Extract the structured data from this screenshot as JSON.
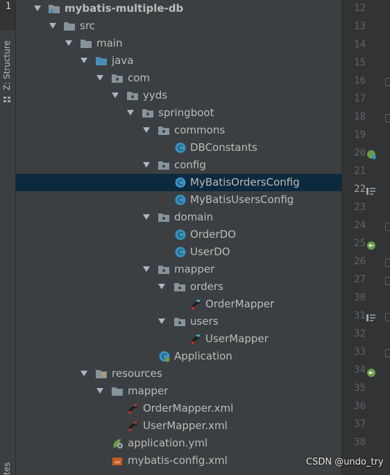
{
  "tool_stripe": {
    "top_number": "1",
    "structure_label": "Z: Structure",
    "bottom_label": "tes"
  },
  "tree": {
    "root": "mybatis-multiple-db",
    "src": "src",
    "main": "main",
    "java": "java",
    "com": "com",
    "yyds": "yyds",
    "springboot": "springboot",
    "commons": "commons",
    "db_constants": "DBConstants",
    "config": "config",
    "orders_config": "MyBatisOrdersConfig",
    "users_config": "MyBatisUsersConfig",
    "domain": "domain",
    "order_do": "OrderDO",
    "user_do": "UserDO",
    "mapper": "mapper",
    "orders": "orders",
    "order_mapper": "OrderMapper",
    "users": "users",
    "user_mapper": "UserMapper",
    "application": "Application",
    "resources": "resources",
    "res_mapper": "mapper",
    "order_mapper_xml": "OrderMapper.xml",
    "user_mapper_xml": "UserMapper.xml",
    "application_yml": "application.yml",
    "mybatis_config_xml": "mybatis-config.xml",
    "selected_item": "MyBatisOrdersConfig"
  },
  "gutter": {
    "lines": [
      "12",
      "13",
      "14",
      "15",
      "16",
      "17",
      "18",
      "19",
      "20",
      "21",
      "22",
      "23",
      "24",
      "25",
      "26",
      "27",
      "30",
      "31",
      "32",
      "33",
      "34",
      "35",
      "36",
      "37",
      "38"
    ],
    "current_line": "22"
  },
  "watermark": "CSDN @undo_try",
  "colors": {
    "panel_bg": "#3c3f41",
    "selection_bg": "#0d293e",
    "tree_text": "#bbbbbb",
    "class_icon": "#3592c4",
    "folder_icon": "#87939a",
    "java_folder": "#4a8eb6",
    "bean_icon": "#6a9d4a",
    "gutter_bg": "#313335",
    "line_number": "#606366"
  }
}
